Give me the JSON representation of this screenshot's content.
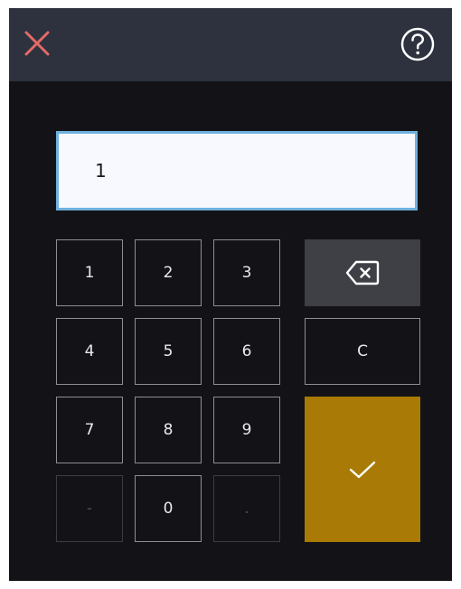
{
  "header": {
    "close_icon": "close-icon",
    "help_icon": "help-icon",
    "close_color": "#e46a67",
    "help_color": "#ffffff"
  },
  "display": {
    "value": "1"
  },
  "keypad": {
    "digits": [
      {
        "label": "1",
        "enabled": true
      },
      {
        "label": "2",
        "enabled": true
      },
      {
        "label": "3",
        "enabled": true
      },
      {
        "label": "4",
        "enabled": true
      },
      {
        "label": "5",
        "enabled": true
      },
      {
        "label": "6",
        "enabled": true
      },
      {
        "label": "7",
        "enabled": true
      },
      {
        "label": "8",
        "enabled": true
      },
      {
        "label": "9",
        "enabled": true
      },
      {
        "label": "-",
        "enabled": false
      },
      {
        "label": "0",
        "enabled": true
      },
      {
        "label": ".",
        "enabled": false
      }
    ],
    "backspace_icon": "backspace-icon",
    "clear_label": "C",
    "confirm_icon": "checkmark-icon",
    "confirm_color": "#a97a05"
  }
}
